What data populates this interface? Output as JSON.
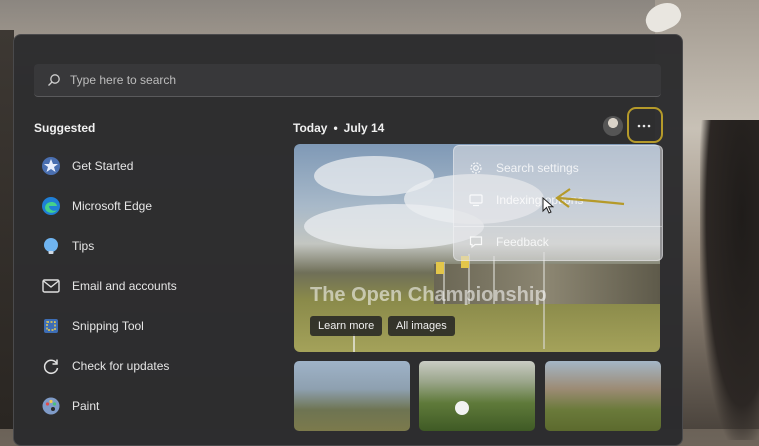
{
  "search": {
    "placeholder": "Type here to search"
  },
  "suggested": {
    "title": "Suggested",
    "items": [
      {
        "label": "Get Started",
        "icon": "get-started-icon"
      },
      {
        "label": "Microsoft Edge",
        "icon": "edge-icon"
      },
      {
        "label": "Tips",
        "icon": "tips-icon"
      },
      {
        "label": "Email and accounts",
        "icon": "mail-icon"
      },
      {
        "label": "Snipping Tool",
        "icon": "snipping-tool-icon"
      },
      {
        "label": "Check for updates",
        "icon": "refresh-icon"
      },
      {
        "label": "Paint",
        "icon": "paint-icon"
      }
    ]
  },
  "today": {
    "label": "Today",
    "date": "July 14"
  },
  "hero": {
    "title": "The Open Championship",
    "learn_more": "Learn more",
    "all_images": "All images"
  },
  "menu": {
    "items": [
      {
        "label": "Search settings",
        "icon": "gear-icon"
      },
      {
        "label": "Indexing options",
        "icon": "indexing-icon"
      },
      {
        "label": "Feedback",
        "icon": "feedback-icon"
      }
    ]
  },
  "colors": {
    "annotation": "#b59a2a",
    "panel": "#2b2b2d",
    "accent_blue": "#3aa0ff"
  }
}
